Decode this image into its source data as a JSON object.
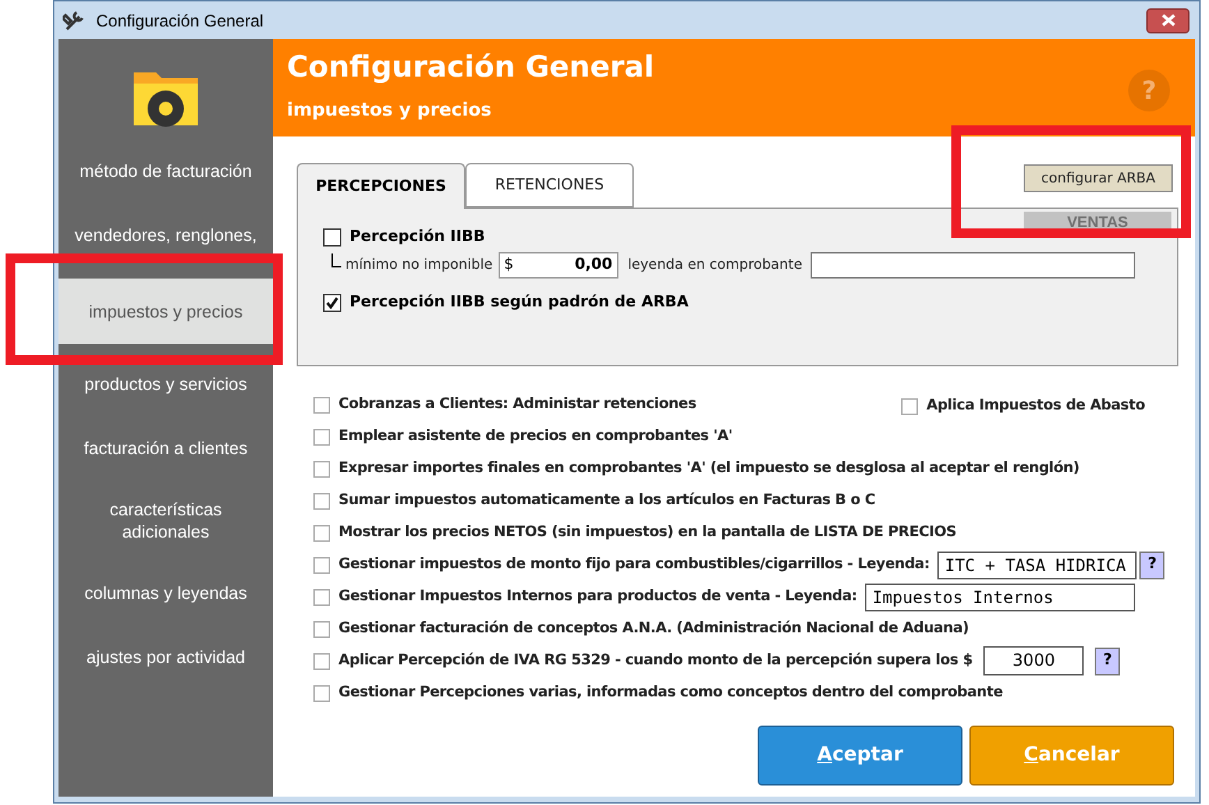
{
  "window": {
    "title": "Configuración General"
  },
  "header": {
    "title": "Configuración General",
    "subtitle": "impuestos y precios",
    "help": "?"
  },
  "sidebar": {
    "items": [
      {
        "label": "método de facturación",
        "selected": false
      },
      {
        "label": "vendedores, renglones,",
        "selected": false
      },
      {
        "label": "impuestos y precios",
        "selected": true
      },
      {
        "label": "productos y servicios",
        "selected": false
      },
      {
        "label": "facturación a clientes",
        "selected": false
      },
      {
        "label": "características adicionales",
        "selected": false
      },
      {
        "label": "columnas y leyendas",
        "selected": false
      },
      {
        "label": "ajustes por actividad",
        "selected": false
      }
    ]
  },
  "tabs": [
    {
      "label": "PERCEPCIONES",
      "selected": true
    },
    {
      "label": "RETENCIONES",
      "selected": false
    }
  ],
  "arba_button": "configurar ARBA",
  "section_label": "VENTAS",
  "percepciones": {
    "iibb": {
      "label": "Percepción IIBB",
      "checked": false
    },
    "minimo_label": "mínimo no imponible",
    "currency": "$",
    "minimo_value": "0,00",
    "leyenda_label": "leyenda en comprobante",
    "padron": {
      "label": "Percepción IIBB según padrón de ARBA",
      "checked": true
    }
  },
  "abasto": {
    "label": "Aplica Impuestos de Abasto",
    "checked": false
  },
  "options": [
    {
      "kind": "plain",
      "label": "Cobranzas a Clientes: Administar retenciones",
      "checked": false
    },
    {
      "kind": "plain",
      "label": "Emplear asistente de precios en comprobantes 'A'",
      "checked": false
    },
    {
      "kind": "plain",
      "label": "Expresar importes finales en comprobantes 'A' (el impuesto se desglosa al aceptar el renglón)",
      "checked": false
    },
    {
      "kind": "plain",
      "label": "Sumar impuestos automaticamente a los artículos en Facturas B o C",
      "checked": false
    },
    {
      "kind": "plain",
      "label": "Mostrar los precios NETOS (sin impuestos) en la pantalla de LISTA DE PRECIOS",
      "checked": false
    },
    {
      "kind": "field_help",
      "label": "Gestionar impuestos de monto fijo para combustibles/cigarrillos - Leyenda:",
      "checked": false,
      "value": "ITC + TASA HIDRICA",
      "help": "?"
    },
    {
      "kind": "field",
      "label": "Gestionar Impuestos Internos para productos de venta  -  Leyenda:",
      "checked": false,
      "value": "Impuestos Internos"
    },
    {
      "kind": "plain",
      "label": "Gestionar facturación de conceptos A.N.A. (Administración Nacional de Aduana)",
      "checked": false
    },
    {
      "kind": "amount_help",
      "label": "Aplicar Percepción de IVA RG 5329 - cuando monto de la percepción supera los $",
      "checked": false,
      "value": "3000",
      "help": "?"
    },
    {
      "kind": "plain",
      "label": "Gestionar Percepciones varias, informadas como conceptos dentro del comprobante",
      "checked": false
    }
  ],
  "buttons": [
    {
      "kind": "accept",
      "label": "Aceptar",
      "mnemonic": true
    },
    {
      "kind": "cancel",
      "label": "Cancelar",
      "mnemonic": true
    }
  ],
  "highlight_frames": [
    {
      "kind": "frame"
    },
    {
      "kind": "frame"
    }
  ]
}
